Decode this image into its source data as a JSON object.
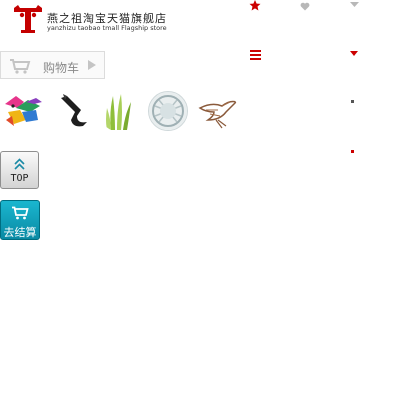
{
  "store": {
    "name": "燕之祖淘宝天猫旗舰店",
    "subtitle": "yanzhizu taobao tmall Flagship store"
  },
  "top_icons": {
    "star": "star-icon",
    "heart": "heart-icon",
    "caret": "caret-down-icon",
    "menu": "menu-icon"
  },
  "cart": {
    "label": "购物车"
  },
  "products": [
    {
      "name": "product-thumbnail-1"
    },
    {
      "name": "product-thumbnail-2"
    },
    {
      "name": "product-thumbnail-3"
    },
    {
      "name": "product-thumbnail-4"
    },
    {
      "name": "product-thumbnail-5"
    }
  ],
  "float_buttons": {
    "top_label": "TOP",
    "checkout_label": "去结算"
  },
  "colors": {
    "accent_red": "#cc0000",
    "checkout_teal": "#13a3bd",
    "muted_gray": "#8a8a8a"
  }
}
